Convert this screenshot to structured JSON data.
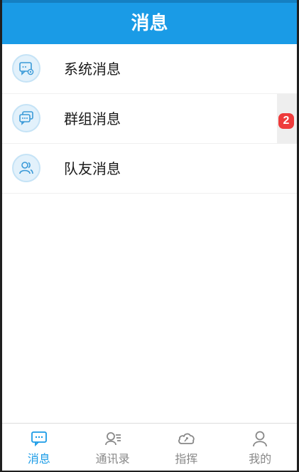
{
  "header": {
    "title": "消息"
  },
  "colors": {
    "accent": "#1a9be6",
    "badge": "#ee3b3b",
    "inactive": "#888888"
  },
  "messages": [
    {
      "label": "系统消息",
      "icon": "system-message-icon",
      "badge": ""
    },
    {
      "label": "群组消息",
      "icon": "group-message-icon",
      "badge": "2"
    },
    {
      "label": "队友消息",
      "icon": "teammate-icon",
      "badge": ""
    }
  ],
  "tabs": [
    {
      "label": "消息",
      "icon": "chat-bubble-icon",
      "active": true
    },
    {
      "label": "通讯录",
      "icon": "contacts-icon",
      "active": false
    },
    {
      "label": "指挥",
      "icon": "cloud-command-icon",
      "active": false
    },
    {
      "label": "我的",
      "icon": "person-icon",
      "active": false
    }
  ]
}
